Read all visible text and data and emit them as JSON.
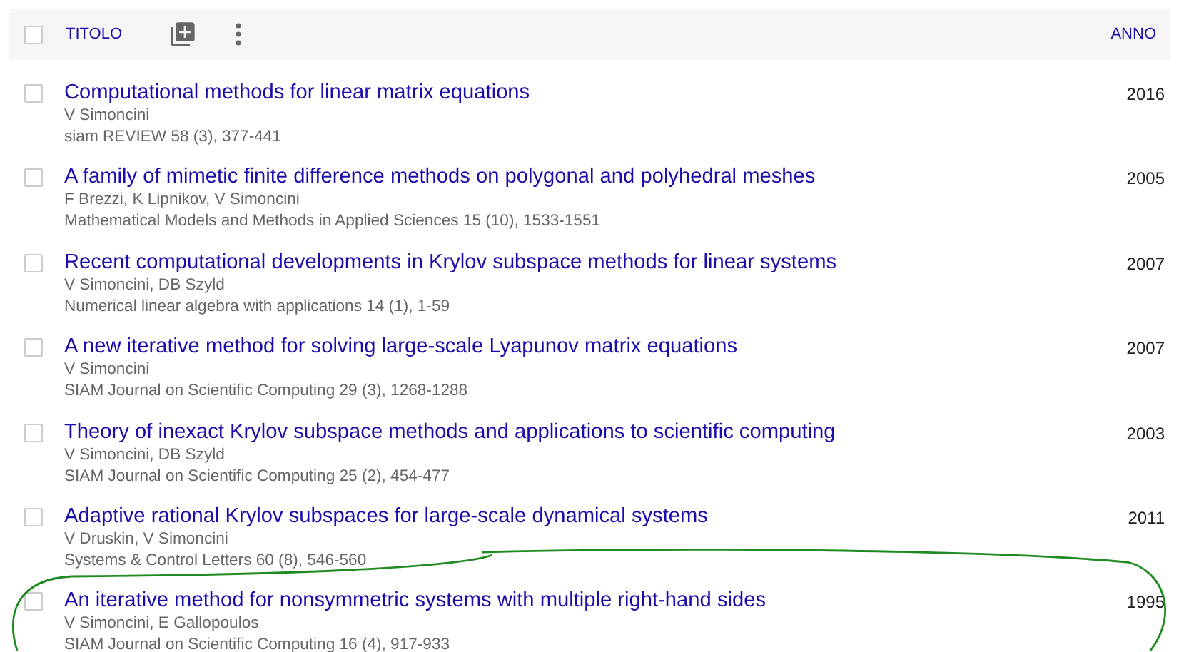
{
  "header": {
    "select_all_checked": false,
    "title_column": "TITOLO",
    "year_column": "ANNO"
  },
  "rows": [
    {
      "checked": false,
      "title": "Computational methods for linear matrix equations",
      "authors": "V Simoncini",
      "venue": "siam REVIEW 58 (3), 377-441",
      "year": "2016"
    },
    {
      "checked": false,
      "title": "A family of mimetic finite difference methods on polygonal and polyhedral meshes",
      "authors": "F Brezzi, K Lipnikov, V Simoncini",
      "venue": "Mathematical Models and Methods in Applied Sciences 15 (10), 1533-1551",
      "year": "2005"
    },
    {
      "checked": false,
      "title": "Recent computational developments in Krylov subspace methods for linear systems",
      "authors": "V Simoncini, DB Szyld",
      "venue": "Numerical linear algebra with applications 14 (1), 1-59",
      "year": "2007"
    },
    {
      "checked": false,
      "title": "A new iterative method for solving large-scale Lyapunov matrix equations",
      "authors": "V Simoncini",
      "venue": "SIAM Journal on Scientific Computing 29 (3), 1268-1288",
      "year": "2007"
    },
    {
      "checked": false,
      "title": "Theory of inexact Krylov subspace methods and applications to scientific computing",
      "authors": "V Simoncini, DB Szyld",
      "venue": "SIAM Journal on Scientific Computing 25 (2), 454-477",
      "year": "2003"
    },
    {
      "checked": false,
      "title": "Adaptive rational Krylov subspaces for large-scale dynamical systems",
      "authors": "V Druskin, V Simoncini",
      "venue": "Systems & Control Letters 60 (8), 546-560",
      "year": "2011"
    },
    {
      "checked": false,
      "title": "An iterative method for nonsymmetric systems with multiple right-hand sides",
      "authors": "V Simoncini, E Gallopoulos",
      "venue": "SIAM Journal on Scientific Computing 16 (4), 917-933",
      "year": "1995"
    }
  ]
}
